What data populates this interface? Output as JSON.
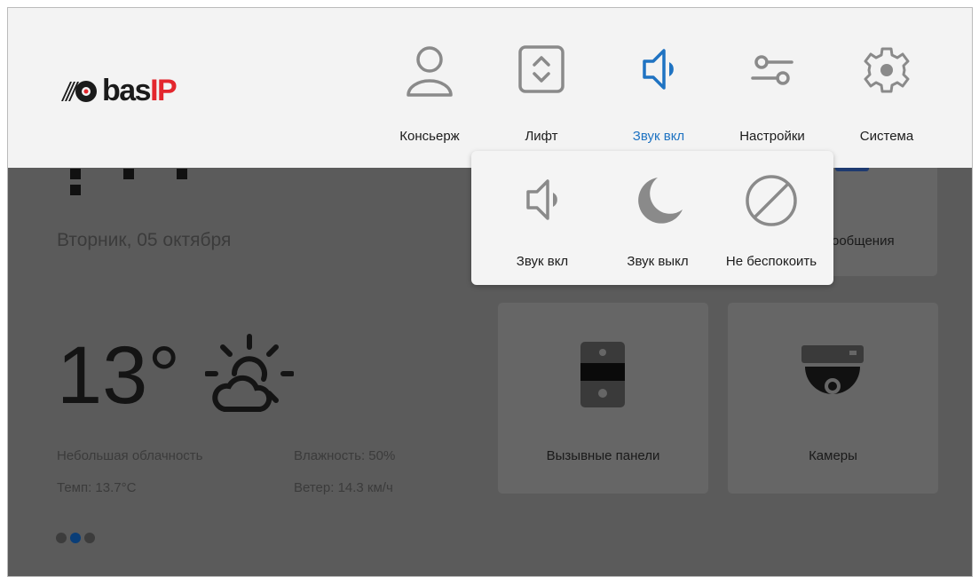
{
  "app": {
    "brand_prefix": "bas",
    "brand_suffix": "IP",
    "colors": {
      "accent": "#1f73c2",
      "brand_red": "#e3262d",
      "active_dot": "#0a3e78"
    }
  },
  "nav": {
    "items": [
      {
        "label": "Консьерж",
        "icon": "person-icon"
      },
      {
        "label": "Лифт",
        "icon": "elevator-icon"
      },
      {
        "label": "Звук вкл",
        "icon": "speaker-icon",
        "active": true
      },
      {
        "label": "Настройки",
        "icon": "sliders-icon"
      },
      {
        "label": "Система",
        "icon": "gear-icon"
      }
    ]
  },
  "sound_menu": {
    "items": [
      {
        "label": "Звук вкл",
        "icon": "speaker-icon"
      },
      {
        "label": "Звук выкл",
        "icon": "moon-icon"
      },
      {
        "label": "Не беспокоить",
        "icon": "do-not-disturb-icon"
      }
    ]
  },
  "home": {
    "date": "Вторник, 05 октября",
    "weather": {
      "temperature": "13°",
      "icon": "partly-cloudy-icon",
      "description": "Небольшая облачность",
      "temp_line": "Темп: 13.7°C",
      "humidity": "Влажность: 50%",
      "wind": "Ветер: 14.3 км/ч"
    },
    "pager": {
      "count": 3,
      "active_index": 1
    },
    "tiles": [
      {
        "label": "ообщения",
        "icon": "messages-icon"
      },
      {
        "label": "Вызывные панели",
        "icon": "door-panel-icon"
      },
      {
        "label": "Камеры",
        "icon": "camera-icon"
      }
    ]
  }
}
